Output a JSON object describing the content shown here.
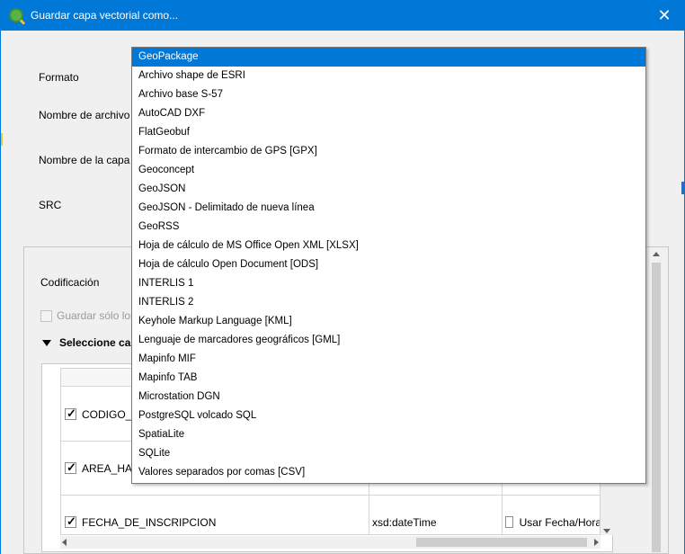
{
  "window": {
    "title": "Guardar capa vectorial como...",
    "close_glyph": "✕",
    "app_icon": "qgis-icon"
  },
  "form": {
    "formato_label": "Formato",
    "nombre_archivo_label": "Nombre de archivo",
    "nombre_capa_label": "Nombre de la capa",
    "src_label": "SRC",
    "codificacion_label": "Codificación",
    "guardar_solo_label": "Guardar sólo los c",
    "guardar_solo_checked": false,
    "seleccione_label": "Seleccione car"
  },
  "dropdown": {
    "selected_index": 0,
    "items": [
      "GeoPackage",
      "Archivo shape de ESRI",
      "Archivo base S-57",
      "AutoCAD DXF",
      "FlatGeobuf",
      "Formato de intercambio de GPS [GPX]",
      "Geoconcept",
      "GeoJSON",
      "GeoJSON - Delimitado de nueva línea",
      "GeoRSS",
      "Hoja de cálculo de MS Office Open XML [XLSX]",
      "Hoja de cálculo Open Document [ODS]",
      "INTERLIS 1",
      "INTERLIS 2",
      "Keyhole Markup Language [KML]",
      "Lenguaje de marcadores geográficos [GML]",
      "Mapinfo MIF",
      "Mapinfo TAB",
      "Microstation DGN",
      "PostgreSQL volcado SQL",
      "SpatiaLite",
      "SQLite",
      "Valores separados por comas [CSV]"
    ]
  },
  "fields_table": {
    "rows": [
      {
        "name": "CODIGO_E",
        "checked": true,
        "type": "",
        "option": "",
        "option_checked": false
      },
      {
        "name": "AREA_HA",
        "checked": true,
        "type": "",
        "option": "",
        "option_checked": false
      },
      {
        "name": "FECHA_DE_INSCRIPCION",
        "checked": true,
        "type": "xsd:dateTime",
        "option": "Usar Fecha/Hora",
        "option_checked": false
      }
    ]
  }
}
